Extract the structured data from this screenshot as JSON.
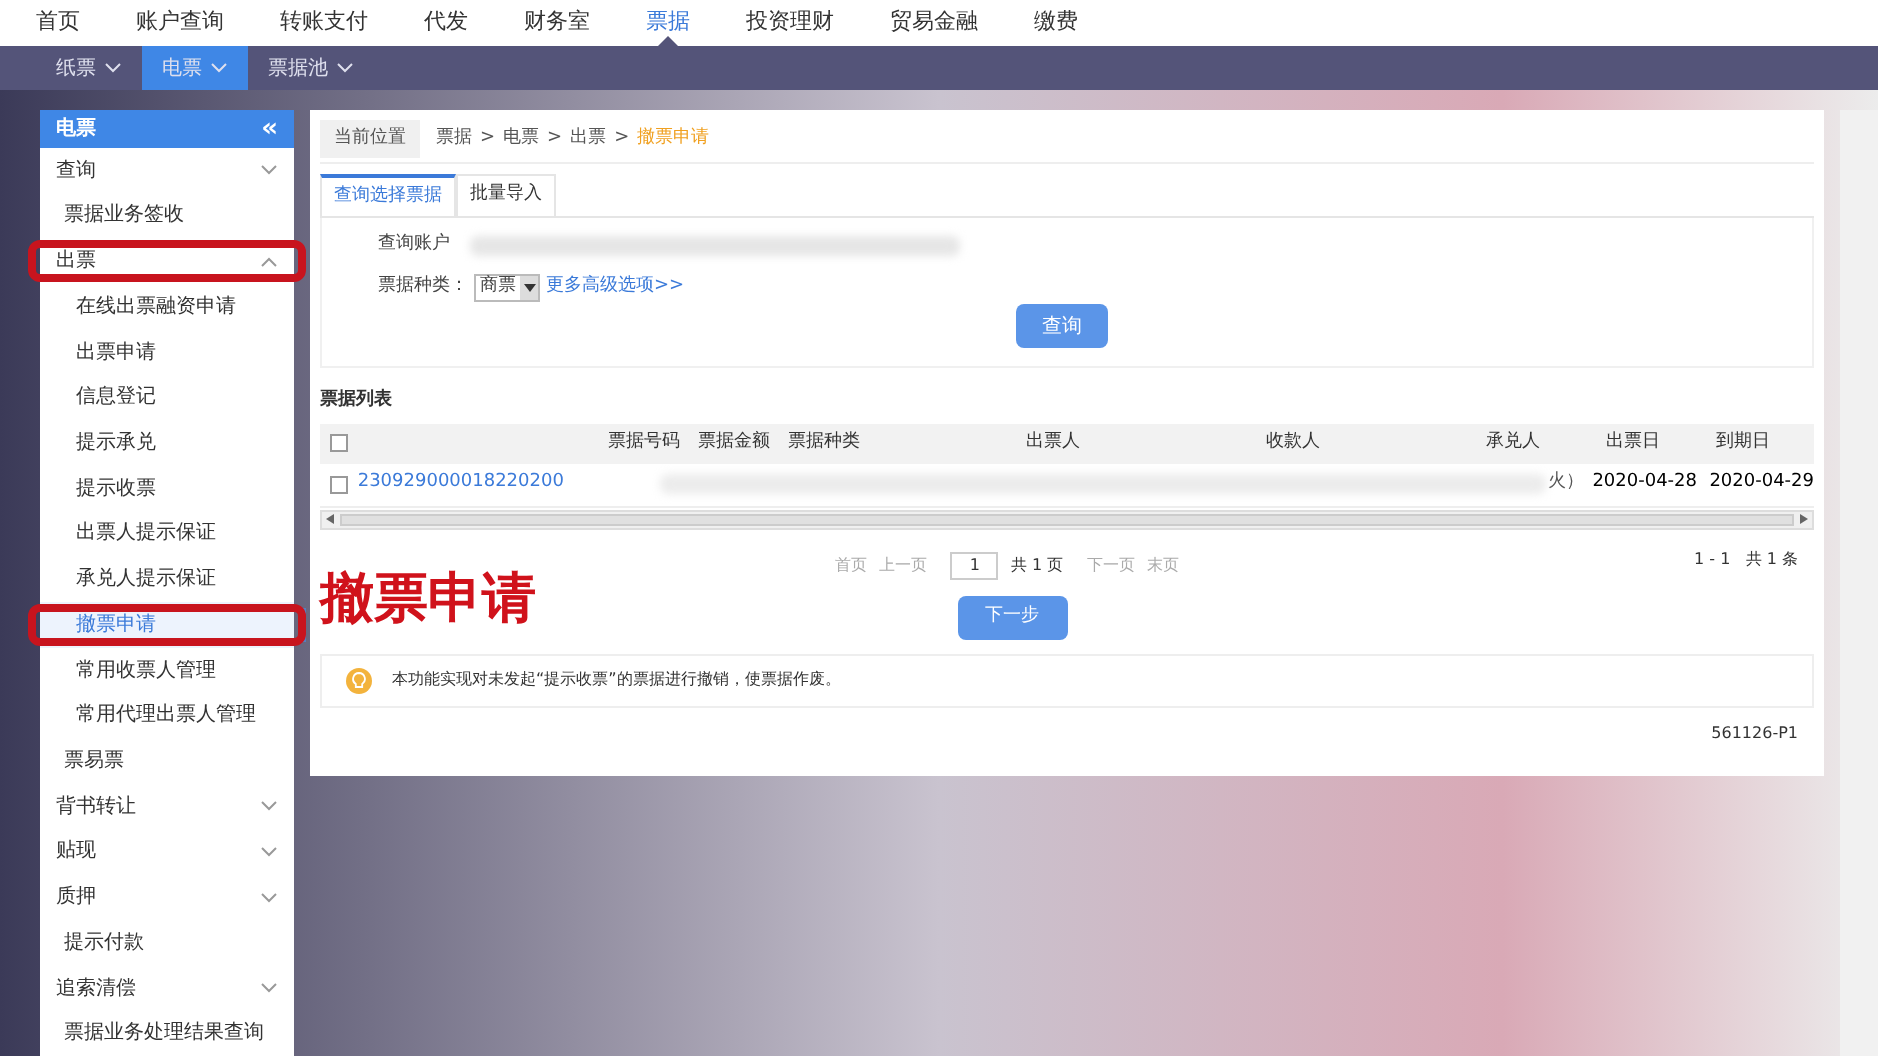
{
  "top_nav": [
    {
      "label": "首页",
      "selected": false
    },
    {
      "label": "账户查询",
      "selected": false
    },
    {
      "label": "转账支付",
      "selected": false
    },
    {
      "label": "代发",
      "selected": false
    },
    {
      "label": "财务室",
      "selected": false
    },
    {
      "label": "票据",
      "selected": true
    },
    {
      "label": "投资理财",
      "selected": false
    },
    {
      "label": "贸易金融",
      "selected": false
    },
    {
      "label": "缴费",
      "selected": false
    }
  ],
  "sub_nav": [
    {
      "label": "纸票",
      "selected": false
    },
    {
      "label": "电票",
      "selected": true
    },
    {
      "label": "票据池",
      "selected": false
    }
  ],
  "sidebar": {
    "title": "电票",
    "collapse": "«",
    "items": [
      {
        "label": "查询",
        "kind": "group",
        "expanded": false,
        "highlighted": false
      },
      {
        "label": "票据业务签收",
        "kind": "link",
        "highlighted": false
      },
      {
        "label": "出票",
        "kind": "group",
        "expanded": true,
        "highlighted": true,
        "children": [
          {
            "label": "在线出票融资申请",
            "selected": false,
            "highlighted": false
          },
          {
            "label": "出票申请",
            "selected": false,
            "highlighted": false
          },
          {
            "label": "信息登记",
            "selected": false,
            "highlighted": false
          },
          {
            "label": "提示承兑",
            "selected": false,
            "highlighted": false
          },
          {
            "label": "提示收票",
            "selected": false,
            "highlighted": false
          },
          {
            "label": "出票人提示保证",
            "selected": false,
            "highlighted": false
          },
          {
            "label": "承兑人提示保证",
            "selected": false,
            "highlighted": false
          },
          {
            "label": "撤票申请",
            "selected": true,
            "highlighted": true
          },
          {
            "label": "常用收票人管理",
            "selected": false,
            "highlighted": false
          },
          {
            "label": "常用代理出票人管理",
            "selected": false,
            "highlighted": false
          }
        ]
      },
      {
        "label": "票易票",
        "kind": "link",
        "highlighted": false
      },
      {
        "label": "背书转让",
        "kind": "group",
        "expanded": false,
        "highlighted": false
      },
      {
        "label": "贴现",
        "kind": "group",
        "expanded": false,
        "highlighted": false
      },
      {
        "label": "质押",
        "kind": "group",
        "expanded": false,
        "highlighted": false
      },
      {
        "label": "提示付款",
        "kind": "link",
        "highlighted": false
      },
      {
        "label": "追索清偿",
        "kind": "group",
        "expanded": false,
        "highlighted": false
      },
      {
        "label": "票据业务处理结果查询",
        "kind": "link",
        "highlighted": false
      }
    ]
  },
  "breadcrumb": {
    "label": "当前位置",
    "path": [
      "票据",
      ">",
      "电票",
      ">",
      "出票",
      ">"
    ],
    "current": "撤票申请"
  },
  "tabs": [
    {
      "label": "查询选择票据",
      "selected": true
    },
    {
      "label": "批量导入",
      "selected": false
    }
  ],
  "form": {
    "account_label": "查询账户",
    "type_label": "票据种类：",
    "type_value": "商票",
    "more_link": "更多高级选项>>",
    "query_button": "查询"
  },
  "table": {
    "title": "票据列表",
    "all_checked": false,
    "columns": [
      "票据号码",
      "票据金额",
      "票据种类",
      "出票人",
      "收款人",
      "承兑人",
      "出票日",
      "到期日"
    ],
    "rows": [
      {
        "checked": false,
        "number": "230929000018220200",
        "partial": "火）",
        "issue_date": "2020-04-28",
        "due_date": "2020-04-29"
      }
    ]
  },
  "pagination": {
    "first": "首页",
    "prev": "上一页",
    "page": "1",
    "total_pages": "共 1 页",
    "next": "下一页",
    "last": "末页",
    "summary": "1 - 1   共 1 条"
  },
  "next_button": "下一步",
  "notice": "本功能实现对未发起“提示收票”的票据进行撤销，使票据作废。",
  "page_code": "561126-P1",
  "annotation": "撤票申请"
}
